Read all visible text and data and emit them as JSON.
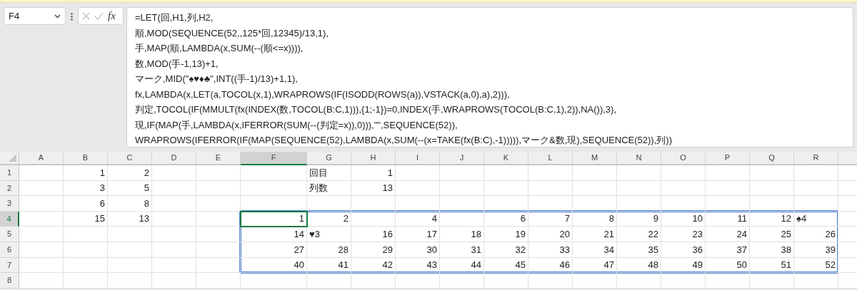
{
  "name_box": {
    "value": "F4"
  },
  "formula_bar": {
    "fx_label": "fx",
    "lines": [
      "=LET(回,H1,列,H2,",
      "順,MOD(SEQUENCE(52,,125*回,12345)/13,1),",
      "手,MAP(順,LAMBDA(x,SUM(--(順<=x)))),",
      "数,MOD(手-1,13)+1,",
      "マーク,MID(\"♠♥♦♣\",INT((手-1)/13)+1,1),",
      "fx,LAMBDA(x,LET(a,TOCOL(x,1),WRAPROWS(IF(ISODD(ROWS(a)),VSTACK(a,0),a),2))),",
      "判定,TOCOL(IF(MMULT(fx(INDEX(数,TOCOL(B:C,1))),{1;-1})=0,INDEX(手,WRAPROWS(TOCOL(B:C,1),2)),NA()),3),",
      "現,IF(MAP(手,LAMBDA(x,IFERROR(SUM(--(判定=x)),0))),\"\",SEQUENCE(52)),",
      "WRAPROWS(IFERROR(IF(MAP(SEQUENCE(52),LAMBDA(x,SUM(--(x=TAKE(fx(B:C),-1))))),マーク&数,現),SEQUENCE(52)),列))"
    ]
  },
  "sheet": {
    "columns": [
      {
        "label": "A",
        "selected": false
      },
      {
        "label": "B",
        "selected": false
      },
      {
        "label": "C",
        "selected": false
      },
      {
        "label": "D",
        "selected": false
      },
      {
        "label": "E",
        "selected": false
      },
      {
        "label": "F",
        "selected": true
      },
      {
        "label": "G",
        "selected": false
      },
      {
        "label": "H",
        "selected": false
      },
      {
        "label": "I",
        "selected": false
      },
      {
        "label": "J",
        "selected": false
      },
      {
        "label": "K",
        "selected": false
      },
      {
        "label": "L",
        "selected": false
      },
      {
        "label": "M",
        "selected": false
      },
      {
        "label": "N",
        "selected": false
      },
      {
        "label": "O",
        "selected": false
      },
      {
        "label": "P",
        "selected": false
      },
      {
        "label": "Q",
        "selected": false
      },
      {
        "label": "R",
        "selected": false
      }
    ],
    "rows": [
      {
        "label": "1",
        "selected": false,
        "cells": [
          {
            "kind": "blank"
          },
          {
            "kind": "number",
            "value": "1"
          },
          {
            "kind": "number",
            "value": "2"
          },
          {
            "kind": "blank"
          },
          {
            "kind": "blank"
          },
          {
            "kind": "blank"
          },
          {
            "kind": "text",
            "value": "回目"
          },
          {
            "kind": "number",
            "value": "1"
          },
          {
            "kind": "blank"
          },
          {
            "kind": "blank"
          },
          {
            "kind": "blank"
          },
          {
            "kind": "blank"
          },
          {
            "kind": "blank"
          },
          {
            "kind": "blank"
          },
          {
            "kind": "blank"
          },
          {
            "kind": "blank"
          },
          {
            "kind": "blank"
          },
          {
            "kind": "blank"
          }
        ]
      },
      {
        "label": "2",
        "selected": false,
        "cells": [
          {
            "kind": "blank"
          },
          {
            "kind": "number",
            "value": "3"
          },
          {
            "kind": "number",
            "value": "5"
          },
          {
            "kind": "blank"
          },
          {
            "kind": "blank"
          },
          {
            "kind": "blank"
          },
          {
            "kind": "text",
            "value": "列数"
          },
          {
            "kind": "number",
            "value": "13"
          },
          {
            "kind": "blank"
          },
          {
            "kind": "blank"
          },
          {
            "kind": "blank"
          },
          {
            "kind": "blank"
          },
          {
            "kind": "blank"
          },
          {
            "kind": "blank"
          },
          {
            "kind": "blank"
          },
          {
            "kind": "blank"
          },
          {
            "kind": "blank"
          },
          {
            "kind": "blank"
          }
        ]
      },
      {
        "label": "3",
        "selected": false,
        "cells": [
          {
            "kind": "blank"
          },
          {
            "kind": "number",
            "value": "6"
          },
          {
            "kind": "number",
            "value": "8"
          },
          {
            "kind": "blank"
          },
          {
            "kind": "blank"
          },
          {
            "kind": "blank"
          },
          {
            "kind": "blank"
          },
          {
            "kind": "blank"
          },
          {
            "kind": "blank"
          },
          {
            "kind": "blank"
          },
          {
            "kind": "blank"
          },
          {
            "kind": "blank"
          },
          {
            "kind": "blank"
          },
          {
            "kind": "blank"
          },
          {
            "kind": "blank"
          },
          {
            "kind": "blank"
          },
          {
            "kind": "blank"
          },
          {
            "kind": "blank"
          }
        ]
      },
      {
        "label": "4",
        "selected": true,
        "cells": [
          {
            "kind": "blank"
          },
          {
            "kind": "number",
            "value": "15"
          },
          {
            "kind": "number",
            "value": "13"
          },
          {
            "kind": "blank"
          },
          {
            "kind": "blank"
          },
          {
            "kind": "number",
            "value": "1",
            "active": true,
            "spill": true
          },
          {
            "kind": "number",
            "value": "2",
            "spill": true
          },
          {
            "kind": "blank",
            "spill": true
          },
          {
            "kind": "number",
            "value": "4",
            "spill": true
          },
          {
            "kind": "blank",
            "spill": true
          },
          {
            "kind": "number",
            "value": "6",
            "spill": true
          },
          {
            "kind": "number",
            "value": "7",
            "spill": true
          },
          {
            "kind": "number",
            "value": "8",
            "spill": true
          },
          {
            "kind": "number",
            "value": "9",
            "spill": true
          },
          {
            "kind": "number",
            "value": "10",
            "spill": true
          },
          {
            "kind": "number",
            "value": "11",
            "spill": true
          },
          {
            "kind": "number",
            "value": "12",
            "spill": true
          },
          {
            "kind": "text",
            "value": "♠4",
            "spill": true
          }
        ]
      },
      {
        "label": "5",
        "selected": false,
        "cells": [
          {
            "kind": "blank"
          },
          {
            "kind": "blank"
          },
          {
            "kind": "blank"
          },
          {
            "kind": "blank"
          },
          {
            "kind": "blank"
          },
          {
            "kind": "number",
            "value": "14",
            "spill": true
          },
          {
            "kind": "text",
            "value": "♥3",
            "spill": true
          },
          {
            "kind": "number",
            "value": "16",
            "spill": true
          },
          {
            "kind": "number",
            "value": "17",
            "spill": true
          },
          {
            "kind": "number",
            "value": "18",
            "spill": true
          },
          {
            "kind": "number",
            "value": "19",
            "spill": true
          },
          {
            "kind": "number",
            "value": "20",
            "spill": true
          },
          {
            "kind": "number",
            "value": "21",
            "spill": true
          },
          {
            "kind": "number",
            "value": "22",
            "spill": true
          },
          {
            "kind": "number",
            "value": "23",
            "spill": true
          },
          {
            "kind": "number",
            "value": "24",
            "spill": true
          },
          {
            "kind": "number",
            "value": "25",
            "spill": true
          },
          {
            "kind": "number",
            "value": "26",
            "spill": true
          }
        ]
      },
      {
        "label": "6",
        "selected": false,
        "cells": [
          {
            "kind": "blank"
          },
          {
            "kind": "blank"
          },
          {
            "kind": "blank"
          },
          {
            "kind": "blank"
          },
          {
            "kind": "blank"
          },
          {
            "kind": "number",
            "value": "27",
            "spill": true
          },
          {
            "kind": "number",
            "value": "28",
            "spill": true
          },
          {
            "kind": "number",
            "value": "29",
            "spill": true
          },
          {
            "kind": "number",
            "value": "30",
            "spill": true
          },
          {
            "kind": "number",
            "value": "31",
            "spill": true
          },
          {
            "kind": "number",
            "value": "32",
            "spill": true
          },
          {
            "kind": "number",
            "value": "33",
            "spill": true
          },
          {
            "kind": "number",
            "value": "34",
            "spill": true
          },
          {
            "kind": "number",
            "value": "35",
            "spill": true
          },
          {
            "kind": "number",
            "value": "36",
            "spill": true
          },
          {
            "kind": "number",
            "value": "37",
            "spill": true
          },
          {
            "kind": "number",
            "value": "38",
            "spill": true
          },
          {
            "kind": "number",
            "value": "39",
            "spill": true
          }
        ]
      },
      {
        "label": "7",
        "selected": false,
        "cells": [
          {
            "kind": "blank"
          },
          {
            "kind": "blank"
          },
          {
            "kind": "blank"
          },
          {
            "kind": "blank"
          },
          {
            "kind": "blank"
          },
          {
            "kind": "number",
            "value": "40",
            "spill": true
          },
          {
            "kind": "number",
            "value": "41",
            "spill": true
          },
          {
            "kind": "number",
            "value": "42",
            "spill": true
          },
          {
            "kind": "number",
            "value": "43",
            "spill": true
          },
          {
            "kind": "number",
            "value": "44",
            "spill": true
          },
          {
            "kind": "number",
            "value": "45",
            "spill": true
          },
          {
            "kind": "number",
            "value": "46",
            "spill": true
          },
          {
            "kind": "number",
            "value": "47",
            "spill": true
          },
          {
            "kind": "number",
            "value": "48",
            "spill": true
          },
          {
            "kind": "number",
            "value": "49",
            "spill": true
          },
          {
            "kind": "number",
            "value": "50",
            "spill": true
          },
          {
            "kind": "number",
            "value": "51",
            "spill": true
          },
          {
            "kind": "number",
            "value": "52",
            "spill": true
          }
        ]
      },
      {
        "label": "8",
        "selected": false,
        "cells": [
          {
            "kind": "blank"
          },
          {
            "kind": "blank"
          },
          {
            "kind": "blank"
          },
          {
            "kind": "blank"
          },
          {
            "kind": "blank"
          },
          {
            "kind": "blank"
          },
          {
            "kind": "blank"
          },
          {
            "kind": "blank"
          },
          {
            "kind": "blank"
          },
          {
            "kind": "blank"
          },
          {
            "kind": "blank"
          },
          {
            "kind": "blank"
          },
          {
            "kind": "blank"
          },
          {
            "kind": "blank"
          },
          {
            "kind": "blank"
          },
          {
            "kind": "blank"
          },
          {
            "kind": "blank"
          },
          {
            "kind": "blank"
          }
        ]
      }
    ]
  }
}
